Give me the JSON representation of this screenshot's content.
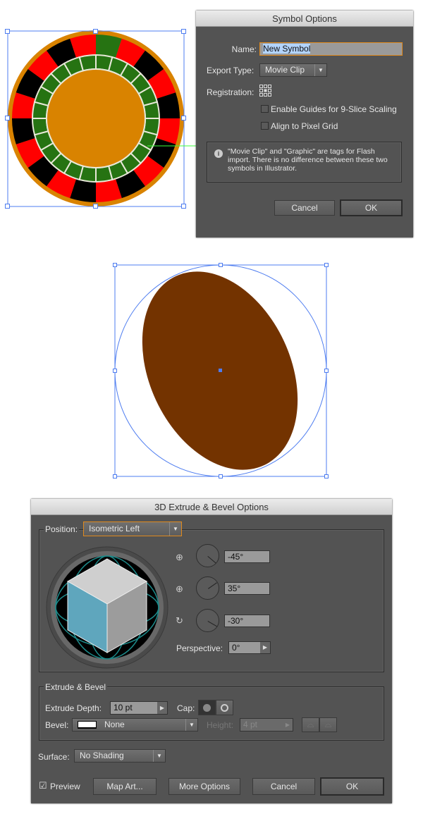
{
  "symbol_options": {
    "title": "Symbol Options",
    "name_label": "Name:",
    "name_value": "New Symbol",
    "export_type_label": "Export Type:",
    "export_type_value": "Movie Clip",
    "registration_label": "Registration:",
    "checkbox_9slice": "Enable Guides for 9-Slice Scaling",
    "checkbox_pixel_grid": "Align to Pixel Grid",
    "info_text": "\"Movie Clip\" and \"Graphic\" are tags for Flash import. There is no difference between these two symbols in Illustrator.",
    "cancel_label": "Cancel",
    "ok_label": "OK"
  },
  "artwork": {
    "wheel_colors": {
      "rim": "#d98300",
      "red": "#ff0000",
      "black": "#000000",
      "green": "#267312",
      "center": "#d98300"
    },
    "ellipse_color": "#733300",
    "selection_color": "#4d7cf0"
  },
  "extrude_dialog": {
    "title": "3D Extrude & Bevel Options",
    "position_label": "Position:",
    "position_value": "Isometric Left",
    "rotation_x": "-45°",
    "rotation_y": "35°",
    "rotation_z": "-30°",
    "perspective_label": "Perspective:",
    "perspective_value": "0°",
    "extrude_bevel_heading": "Extrude & Bevel",
    "extrude_depth_label": "Extrude Depth:",
    "extrude_depth_value": "10 pt",
    "cap_label": "Cap:",
    "bevel_label": "Bevel:",
    "bevel_value": "None",
    "height_label": "Height:",
    "height_value": "4 pt",
    "surface_label": "Surface:",
    "surface_value": "No Shading",
    "preview_label": "Preview",
    "preview_checked": true,
    "map_art_label": "Map Art...",
    "more_options_label": "More Options",
    "cancel_label": "Cancel",
    "ok_label": "OK"
  }
}
